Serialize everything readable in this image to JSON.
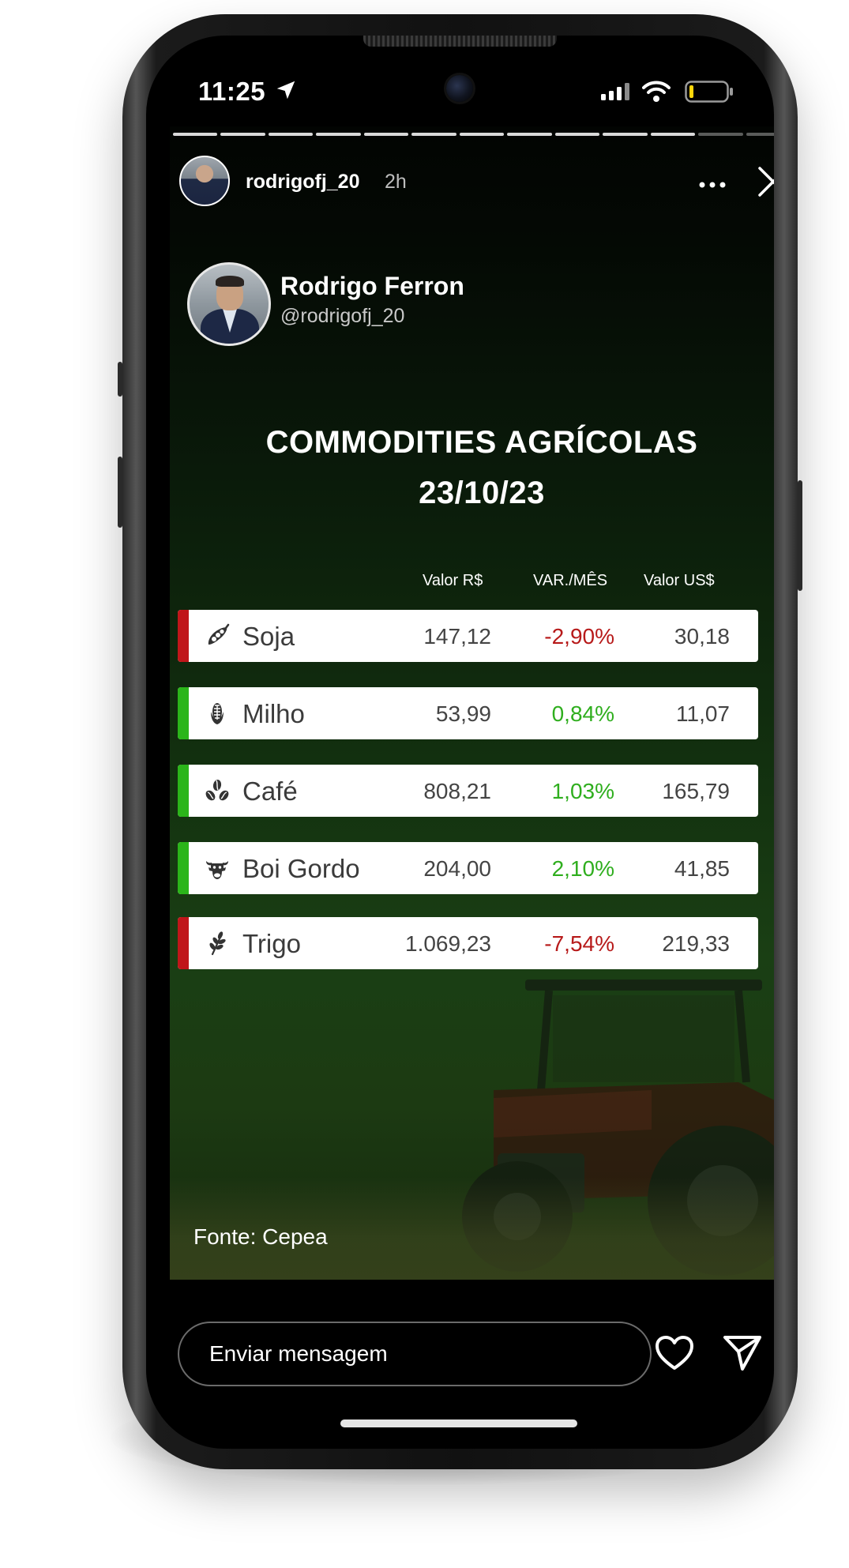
{
  "status_bar": {
    "time": "11:25"
  },
  "story": {
    "username": "rodrigofj_20",
    "posted_ago": "2h",
    "profile_name": "Rodrigo Ferron",
    "profile_handle": "@rodrigofj_20",
    "title_line1": "COMMODITIES AGRÍCOLAS",
    "title_line2": "23/10/23",
    "source": "Fonte: Cepea",
    "progress": {
      "segments": 13,
      "viewed": 11
    }
  },
  "table": {
    "headers": {
      "brl": "Valor R$",
      "var": "VAR./MÊS",
      "usd": "Valor US$"
    },
    "rows": [
      {
        "name": "Soja",
        "icon": "soy-icon",
        "brl": "147,12",
        "var": "-2,90%",
        "usd": "30,18",
        "trend": "down"
      },
      {
        "name": "Milho",
        "icon": "corn-icon",
        "brl": "53,99",
        "var": "0,84%",
        "usd": "11,07",
        "trend": "up"
      },
      {
        "name": "Café",
        "icon": "coffee-icon",
        "brl": "808,21",
        "var": "1,03%",
        "usd": "165,79",
        "trend": "up"
      },
      {
        "name": "Boi Gordo",
        "icon": "cattle-icon",
        "brl": "204,00",
        "var": "2,10%",
        "usd": "41,85",
        "trend": "up"
      },
      {
        "name": "Trigo",
        "icon": "wheat-icon",
        "brl": "1.069,23",
        "var": "-7,54%",
        "usd": "219,33",
        "trend": "down"
      }
    ]
  },
  "footer": {
    "message_placeholder": "Enviar mensagem"
  },
  "colors": {
    "up": "#2fae1e",
    "down": "#b71a1a",
    "up_bar": "#2bb51a",
    "down_bar": "#c0161a"
  }
}
